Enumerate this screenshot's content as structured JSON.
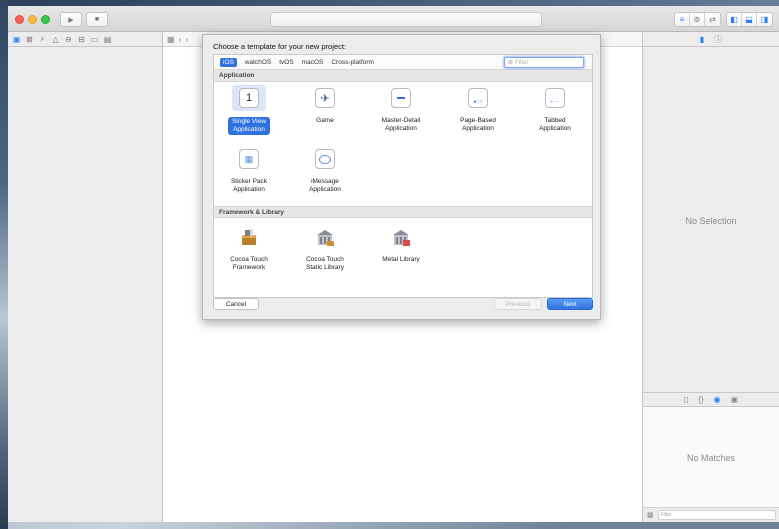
{
  "toolbar": {
    "run_icon": "play-icon",
    "stop_icon": "stop-icon",
    "editor_modes": [
      "standard-editor-icon",
      "assistant-editor-icon",
      "version-editor-icon"
    ],
    "view_toggles": [
      "navigator-toggle-icon",
      "debug-area-toggle-icon",
      "utilities-toggle-icon"
    ]
  },
  "navigator": {
    "tabs": [
      "folder-icon",
      "source-control-icon",
      "search-icon",
      "warning-icon",
      "test-icon",
      "debug-icon",
      "breakpoint-icon",
      "report-icon"
    ]
  },
  "dialog": {
    "title": "Choose a template for your new project:",
    "platforms": [
      {
        "label": "iOS",
        "selected": true
      },
      {
        "label": "watchOS",
        "selected": false
      },
      {
        "label": "tvOS",
        "selected": false
      },
      {
        "label": "macOS",
        "selected": false
      },
      {
        "label": "Cross-platform",
        "selected": false
      }
    ],
    "filter_placeholder": "Filter",
    "sections": {
      "application": "Application",
      "framework": "Framework & Library"
    },
    "application_templates": [
      {
        "line1": "Single View",
        "line2": "Application",
        "icon": "single-view-icon",
        "selected": true
      },
      {
        "line1": "Game",
        "line2": "",
        "icon": "game-icon",
        "selected": false
      },
      {
        "line1": "Master-Detail",
        "line2": "Application",
        "icon": "master-detail-icon",
        "selected": false
      },
      {
        "line1": "Page-Based",
        "line2": "Application",
        "icon": "page-based-icon",
        "selected": false
      },
      {
        "line1": "Tabbed",
        "line2": "Application",
        "icon": "tabbed-icon",
        "selected": false
      },
      {
        "line1": "Sticker Pack",
        "line2": "Application",
        "icon": "sticker-pack-icon",
        "selected": false
      },
      {
        "line1": "iMessage",
        "line2": "Application",
        "icon": "imessage-icon",
        "selected": false
      }
    ],
    "framework_templates": [
      {
        "line1": "Cocoa Touch",
        "line2": "Framework",
        "icon": "framework-toolbox-icon"
      },
      {
        "line1": "Cocoa Touch",
        "line2": "Static Library",
        "icon": "static-library-icon"
      },
      {
        "line1": "Metal Library",
        "line2": "",
        "icon": "metal-library-icon"
      }
    ],
    "buttons": {
      "cancel": "Cancel",
      "previous": "Previous",
      "next": "Next"
    }
  },
  "inspector": {
    "no_selection": "No Selection",
    "no_matches": "No Matches",
    "filter_placeholder": "Filter"
  },
  "colors": {
    "accent": "#2f72e0",
    "selection_tint": "#d9e6fb"
  }
}
